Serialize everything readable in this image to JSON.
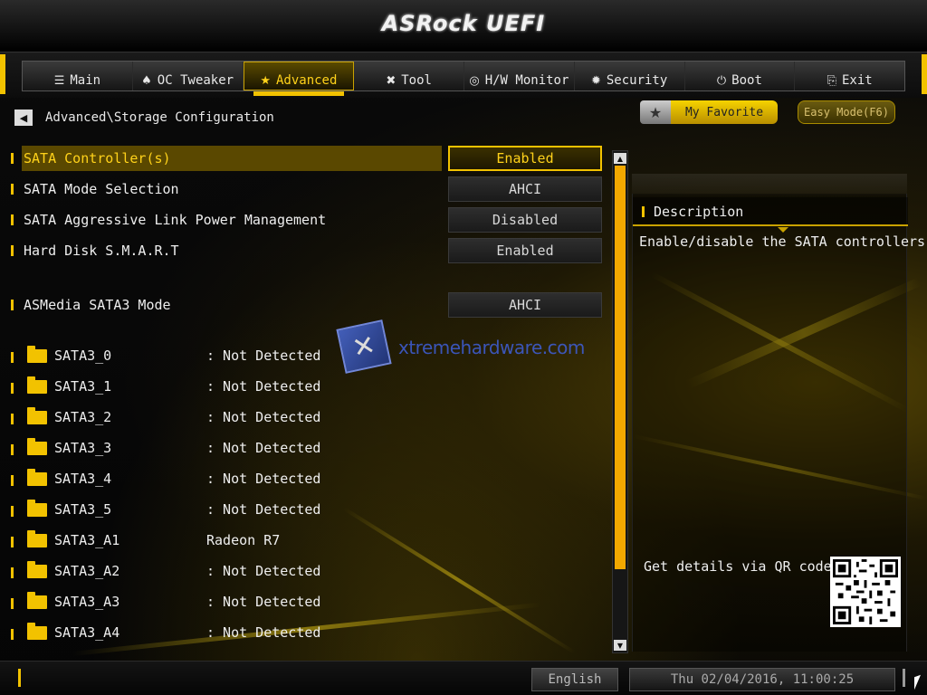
{
  "header": {
    "logo": "ASRock UEFI"
  },
  "nav": {
    "tabs": [
      {
        "label": "Main",
        "icon": "list-icon",
        "glyph": "☰"
      },
      {
        "label": "OC Tweaker",
        "icon": "rocket-icon",
        "glyph": "♠"
      },
      {
        "label": "Advanced",
        "icon": "star-icon",
        "glyph": "★",
        "active": true
      },
      {
        "label": "Tool",
        "icon": "tools-icon",
        "glyph": "✖"
      },
      {
        "label": "H/W Monitor",
        "icon": "monitor-icon",
        "glyph": "◎"
      },
      {
        "label": "Security",
        "icon": "shield-icon",
        "glyph": "✹"
      },
      {
        "label": "Boot",
        "icon": "power-icon",
        "glyph": "⏻"
      },
      {
        "label": "Exit",
        "icon": "exit-icon",
        "glyph": "⎘"
      }
    ]
  },
  "breadcrumb": {
    "back_glyph": "◀",
    "path": "Advanced\\Storage Configuration"
  },
  "favorites": {
    "star_glyph": "★",
    "my_favorite": "My Favorite",
    "easy_mode": "Easy Mode(F6)"
  },
  "settings": [
    {
      "label": "SATA Controller(s)",
      "value": "Enabled",
      "selected": true
    },
    {
      "label": "SATA Mode Selection",
      "value": "AHCI"
    },
    {
      "label": "SATA Aggressive Link Power Management",
      "value": "Disabled"
    },
    {
      "label": "Hard Disk S.M.A.R.T",
      "value": "Enabled"
    },
    {
      "label": "ASMedia SATA3 Mode",
      "value": "AHCI"
    }
  ],
  "drives": [
    {
      "name": "SATA3_0",
      "value": ": Not Detected"
    },
    {
      "name": "SATA3_1",
      "value": ": Not Detected"
    },
    {
      "name": "SATA3_2",
      "value": ": Not Detected"
    },
    {
      "name": "SATA3_3",
      "value": ": Not Detected"
    },
    {
      "name": "SATA3_4",
      "value": ": Not Detected"
    },
    {
      "name": "SATA3_5",
      "value": ": Not Detected"
    },
    {
      "name": "SATA3_A1",
      "value": "Radeon R7"
    },
    {
      "name": "SATA3_A2",
      "value": ": Not Detected"
    },
    {
      "name": "SATA3_A3",
      "value": ": Not Detected"
    },
    {
      "name": "SATA3_A4",
      "value": ": Not Detected"
    }
  ],
  "scroll": {
    "up_glyph": "▲",
    "down_glyph": "▼"
  },
  "description": {
    "title": "Description",
    "text": "Enable/disable the SATA controllers.",
    "qr_label": "Get details via QR code"
  },
  "footer": {
    "language": "English",
    "datetime": "Thu 02/04/2016, 11:00:25"
  },
  "watermark": {
    "glyph": "✕",
    "text": "xtremehardware.com"
  },
  "colors": {
    "accent": "#f2c200",
    "selected_bg": "#5a4800",
    "scroll_thumb": "#f2a800"
  }
}
